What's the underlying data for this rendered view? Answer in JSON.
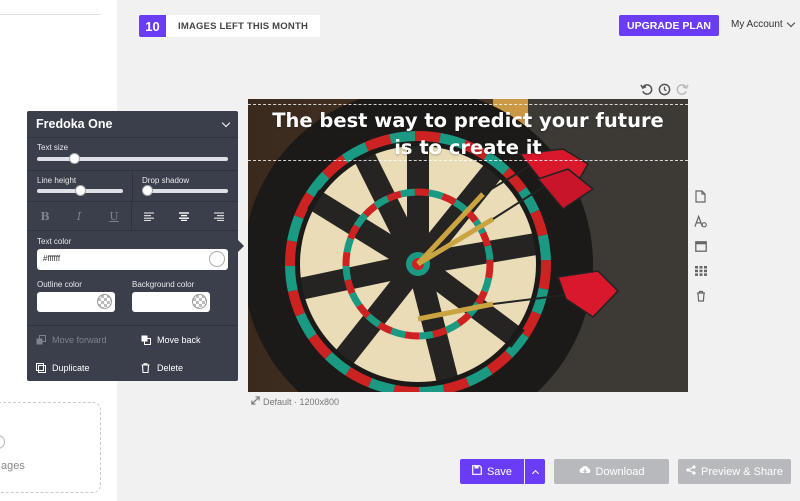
{
  "sidebar": {
    "upload_label": "ages"
  },
  "header": {
    "images_left_count": "10",
    "images_left_text": "IMAGES LEFT THIS MONTH",
    "upgrade_label": "UPGRADE PLAN",
    "account_label": "My Account"
  },
  "canvas": {
    "quote_line1": "The best way to predict your future",
    "quote_line2": "is to create it",
    "size_caption": "Default · 1200x800"
  },
  "text_panel": {
    "font_name": "Fredoka One",
    "text_size_label": "Text size",
    "text_size_value": 0.18,
    "line_height_label": "Line height",
    "line_height_value": 0.5,
    "drop_shadow_label": "Drop shadow",
    "drop_shadow_value": 0.0,
    "text_color_label": "Text color",
    "text_color_value": "#ffffff",
    "outline_color_label": "Outline color",
    "background_color_label": "Background color",
    "move_forward_label": "Move forward",
    "move_back_label": "Move back",
    "duplicate_label": "Duplicate",
    "delete_label": "Delete"
  },
  "footer": {
    "save_label": "Save",
    "download_label": "Download",
    "share_label": "Preview & Share"
  },
  "colors": {
    "accent": "#6b3cf5",
    "panel_bg": "#3a3f4b",
    "disabled_button": "#b8b9bd"
  },
  "icons": [
    "undo-icon",
    "history-icon",
    "redo-icon",
    "page-icon",
    "text-style-icon",
    "frame-icon",
    "grid-icon",
    "trash-icon",
    "resize-icon",
    "save-icon",
    "cloud-download-icon",
    "share-icon",
    "bold-icon",
    "italic-icon",
    "underline-icon",
    "align-left-icon",
    "align-center-icon",
    "align-right-icon",
    "move-forward-icon",
    "move-back-icon",
    "duplicate-icon",
    "delete-icon",
    "chevron-down-icon"
  ]
}
